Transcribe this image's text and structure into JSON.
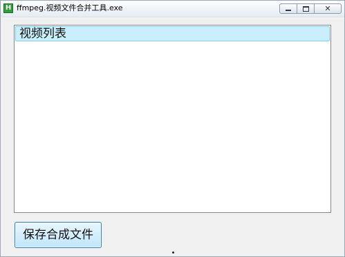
{
  "window": {
    "title": "ffmpeg.视频文件合并工具.exe",
    "icon": "app-icon",
    "icon_letter": "H",
    "controls": [
      "minimize-icon",
      "maximize-icon",
      "close-icon"
    ],
    "close_glyph": "✕"
  },
  "list": {
    "header": "视频列表",
    "items": []
  },
  "actions": {
    "save_label": "保存合成文件"
  },
  "colors": {
    "list_header_bg": "#cbeefc",
    "button_border": "#3c7fb1",
    "window_bg": "#f0f0f0"
  }
}
